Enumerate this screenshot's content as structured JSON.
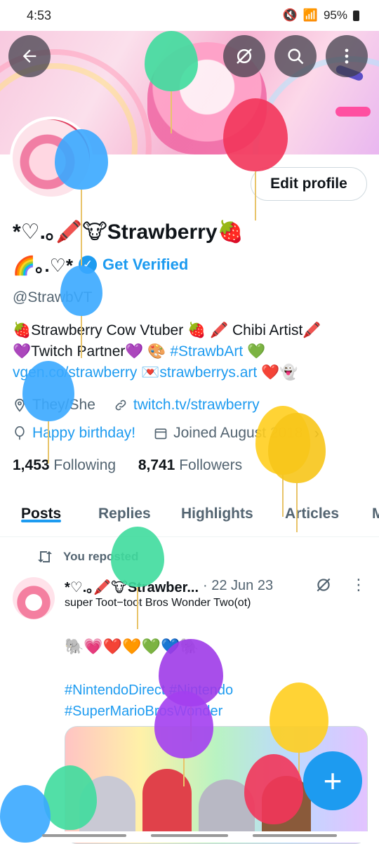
{
  "status_bar": {
    "time": "4:53",
    "battery": "95%"
  },
  "colors": {
    "accent": "#1d9bf0",
    "text": "#0f1419",
    "muted": "#536471"
  },
  "header_buttons": {
    "back_icon": "arrow-left-icon",
    "hidden_icon": "eye-slash-icon",
    "search_icon": "search-icon",
    "more_icon": "more-vertical-icon"
  },
  "profile": {
    "edit_label": "Edit profile",
    "display_name": "*♡.｡🖍️🐮Strawberry🍓",
    "name_line2": "🌈｡.♡*",
    "get_verified": "Get Verified",
    "handle": "@StrawbVT",
    "bio": {
      "line1": "🍓Strawberry Cow Vtuber 🍓 🖍️ Chibi Artist🖍️",
      "line2_pre": "💜Twitch Partner💜 🎨 ",
      "tag": "#StrawbArt",
      "line2_mid": " 💚",
      "vgen": "vgen.co/strawberry",
      "line3_mid": " 💌",
      "site": "strawberrys.art",
      "line3_end": " ❤️👻"
    },
    "pronouns": "They/She",
    "website": "twitch.tv/strawberry",
    "birthday": "Happy birthday!",
    "joined": "Joined August 2018",
    "following_count": "1,453",
    "following_label": "Following",
    "followers_count": "8,741",
    "followers_label": "Followers"
  },
  "tabs": [
    "Posts",
    "Replies",
    "Highlights",
    "Articles",
    "M"
  ],
  "tweet": {
    "repost_label": "You reposted",
    "author": "*♡.｡🖍️🐮Strawber...",
    "date": "· 22 Jun 23",
    "text": "super Toot−toot Bros Wonder Two(ot)",
    "emojis": "🐘💗❤️🧡💚💙🐘",
    "tag1": "#NintendoDirect",
    "tag2": "#Nintendo",
    "tag3": "#SuperMarioBrosWonder"
  },
  "fab_label": "+"
}
